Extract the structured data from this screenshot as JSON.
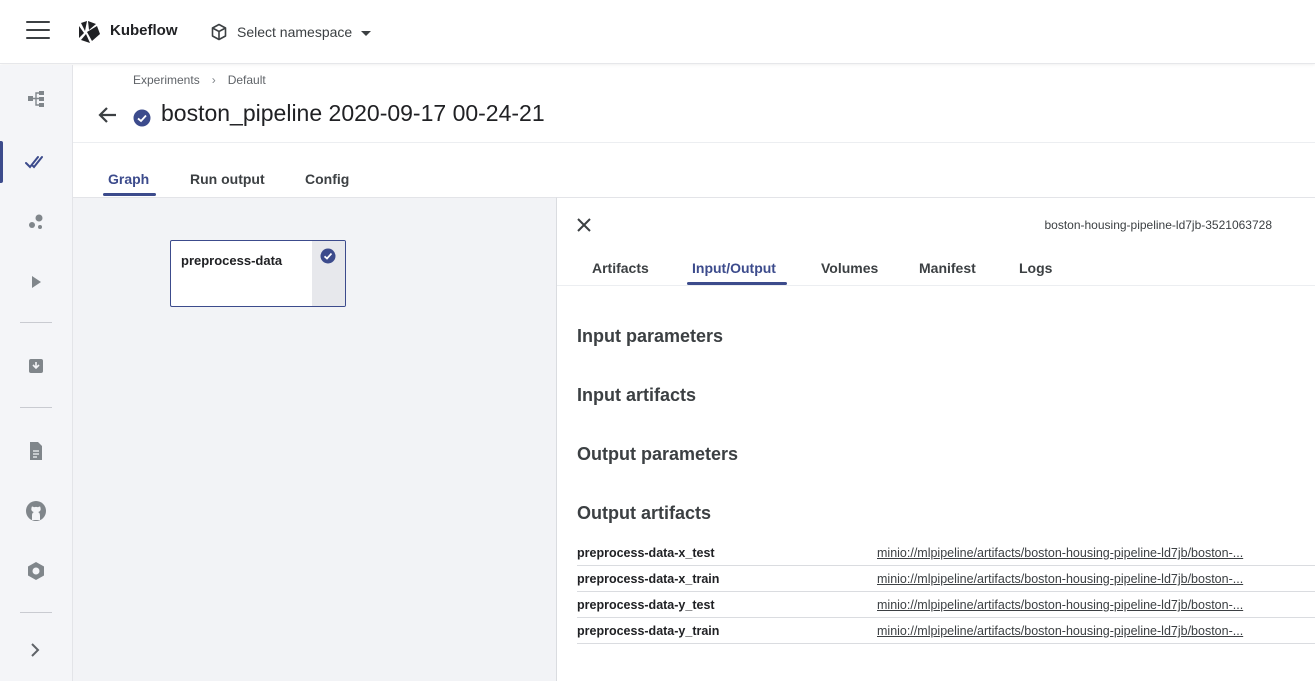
{
  "app": {
    "brand": "Kubeflow"
  },
  "namespace": {
    "label": "Select namespace"
  },
  "breadcrumb": {
    "items": [
      "Experiments",
      "Default"
    ],
    "separator": "›"
  },
  "page": {
    "title": "boston_pipeline 2020-09-17 00-24-21",
    "status": "succeeded"
  },
  "tabs": [
    {
      "label": "Graph",
      "active": true
    },
    {
      "label": "Run output",
      "active": false
    },
    {
      "label": "Config",
      "active": false
    }
  ],
  "graph": {
    "nodes": [
      {
        "label": "preprocess-data",
        "status": "succeeded"
      }
    ]
  },
  "details": {
    "pod_id": "boston-housing-pipeline-ld7jb-3521063728",
    "tabs": [
      {
        "label": "Artifacts",
        "active": false
      },
      {
        "label": "Input/Output",
        "active": true
      },
      {
        "label": "Volumes",
        "active": false
      },
      {
        "label": "Manifest",
        "active": false
      },
      {
        "label": "Logs",
        "active": false
      }
    ],
    "sections": {
      "input_parameters": "Input parameters",
      "input_artifacts": "Input artifacts",
      "output_parameters": "Output parameters",
      "output_artifacts": "Output artifacts"
    },
    "output_artifacts": [
      {
        "name": "preprocess-data-x_test",
        "link": "minio://mlpipeline/artifacts/boston-housing-pipeline-ld7jb/boston-..."
      },
      {
        "name": "preprocess-data-x_train",
        "link": "minio://mlpipeline/artifacts/boston-housing-pipeline-ld7jb/boston-..."
      },
      {
        "name": "preprocess-data-y_test",
        "link": "minio://mlpipeline/artifacts/boston-housing-pipeline-ld7jb/boston-..."
      },
      {
        "name": "preprocess-data-y_train",
        "link": "minio://mlpipeline/artifacts/boston-housing-pipeline-ld7jb/boston-..."
      }
    ]
  },
  "sidebar": {
    "icons": [
      "pipelines-icon",
      "runs-icon",
      "experiments-icon",
      "play-icon",
      "archive-icon",
      "document-icon",
      "github-icon",
      "kubeflow-hex-icon",
      "chevron-right-icon"
    ],
    "active": "runs-icon"
  },
  "colors": {
    "accent": "#3c4b8c",
    "sidebar_bg": "#f4f5f8",
    "graph_bg": "#f2f3f6"
  }
}
